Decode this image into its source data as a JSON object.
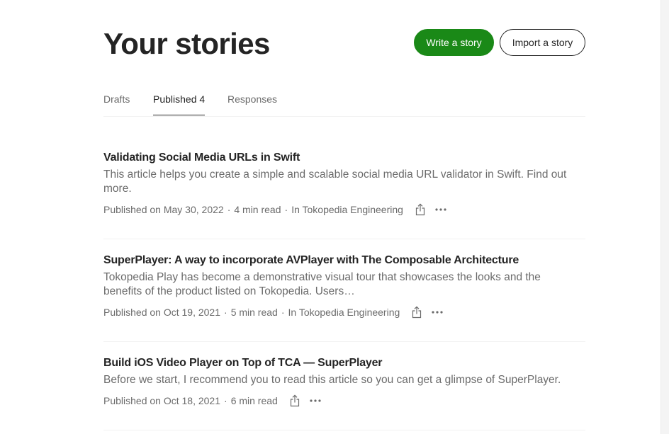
{
  "page": {
    "title": "Your stories"
  },
  "actions": {
    "write_label": "Write a story",
    "import_label": "Import a story"
  },
  "tabs": [
    {
      "label": "Drafts",
      "active": false
    },
    {
      "label": "Published 4",
      "active": true
    },
    {
      "label": "Responses",
      "active": false
    }
  ],
  "stories": [
    {
      "title": "Validating Social Media URLs in Swift",
      "description": "This article helps you create a simple and scalable social media URL validator in Swift. Find out more.",
      "published": "Published on May 30, 2022",
      "read_time": "4 min read",
      "publication": "In Tokopedia Engineering"
    },
    {
      "title": "SuperPlayer: A way to incorporate AVPlayer with The Composable Architecture",
      "description": "Tokopedia Play has become a demonstrative visual tour that showcases the looks and the benefits of the product listed on Tokopedia. Users…",
      "published": "Published on Oct 19, 2021",
      "read_time": "5 min read",
      "publication": "In Tokopedia Engineering"
    },
    {
      "title": "Build iOS Video Player on Top of TCA — SuperPlayer",
      "description": "Before we start, I recommend you to read this article so you can get a glimpse of SuperPlayer.",
      "published": "Published on Oct 18, 2021",
      "read_time": "6 min read",
      "publication": ""
    }
  ],
  "meta_separator": "·",
  "icons": {
    "share": "share-icon",
    "more": "more-icon"
  },
  "colors": {
    "accent": "#1a8917",
    "text": "#242424",
    "muted": "#6b6b6b",
    "divider": "#f2f2f2"
  }
}
